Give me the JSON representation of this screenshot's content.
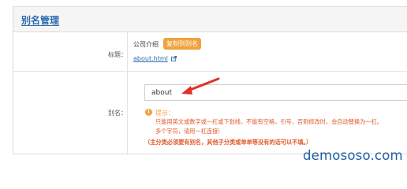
{
  "panel": {
    "title": "别名管理"
  },
  "title_row": {
    "label": "标题：",
    "value": "公司介绍",
    "copy_button": "复制到别名",
    "link_text": "about.html",
    "link_icon": "external-link-icon"
  },
  "alias_row": {
    "label": "别名：",
    "input_value": "about",
    "annotation": "red-arrow-icon",
    "tip_icon": "info-icon",
    "tip_title": "提示：",
    "tip_lines": [
      "只能用英文或数字或一杠或下划线，不能有空格，引号，否则修改时，会自动替换为一杠。",
      "多个字符，请用一杠连接）",
      "（主分类必须要有别名，其他子分类或单单等没有的话可以不填。）"
    ]
  },
  "watermark": "demososo.com",
  "colors": {
    "accent": "#f0a23c",
    "link": "#2b6cae",
    "tip": "#e05a2a",
    "arrow": "#e0302a"
  }
}
